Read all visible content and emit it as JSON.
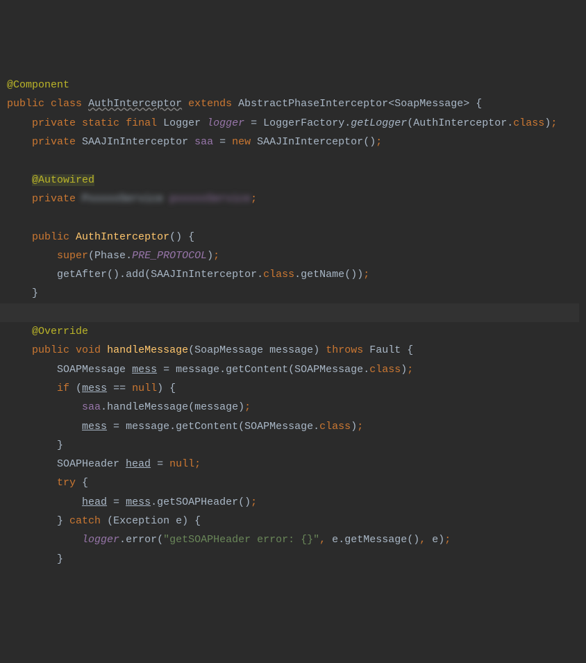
{
  "code": {
    "anno_component": "@Component",
    "kw_public": "public",
    "kw_class": "class",
    "cls_auth": "AuthInterceptor",
    "kw_extends": "extends",
    "cls_abstract": "AbstractPhaseInterceptor",
    "lt": "<",
    "cls_soapmsg": "SoapMessage",
    "gt": ">",
    "brace_o": " {",
    "kw_private": "private",
    "kw_static": "static",
    "kw_final": "final",
    "cls_logger": "Logger",
    "fld_logger": "logger",
    "eq": " = ",
    "cls_logfac": "LoggerFactory",
    "dot": ".",
    "m_getlogger": "getLogger",
    "paren_o": "(",
    "paren_c": ")",
    "kw_classref": "class",
    "semi": ";",
    "cls_saaj": "SAAJInInterceptor",
    "fld_saa": "saa",
    "kw_new": "new",
    "anno_autowired": "@Autowired",
    "cls_blur1": "PxxxxxService",
    "fld_blur1": "pxxxxxService",
    "ctor_name": "AuthInterceptor",
    "empty_par": "()",
    "kw_super": "super",
    "cls_phase": "Phase",
    "const_preproto": "PRE_PROTOCOL",
    "m_getafter": "getAfter",
    "m_add": "add",
    "m_getname": "getName",
    "brace_c": "}",
    "anno_override": "@Override",
    "kw_void": "void",
    "m_handlemsg": "handleMessage",
    "p_message": "message",
    "kw_throws": "throws",
    "cls_fault": "Fault",
    "cls_soapmsgc": "SOAPMessage",
    "var_mess": "mess",
    "m_getcontent": "getContent",
    "kw_if": "if",
    "kw_null": "null",
    "eqeq": " == ",
    "m_handlemsg2": "handleMessage",
    "cls_soaphdr": "SOAPHeader",
    "var_head": "head",
    "kw_try": "try",
    "m_getsoaphdr": "getSOAPHeader",
    "kw_catch": "catch",
    "cls_exc": "Exception",
    "p_e": "e",
    "m_error": "error",
    "str_err": "\"getSOAPHeader error: {}\"",
    "comma": ",",
    "m_getmsg": "getMessage"
  }
}
